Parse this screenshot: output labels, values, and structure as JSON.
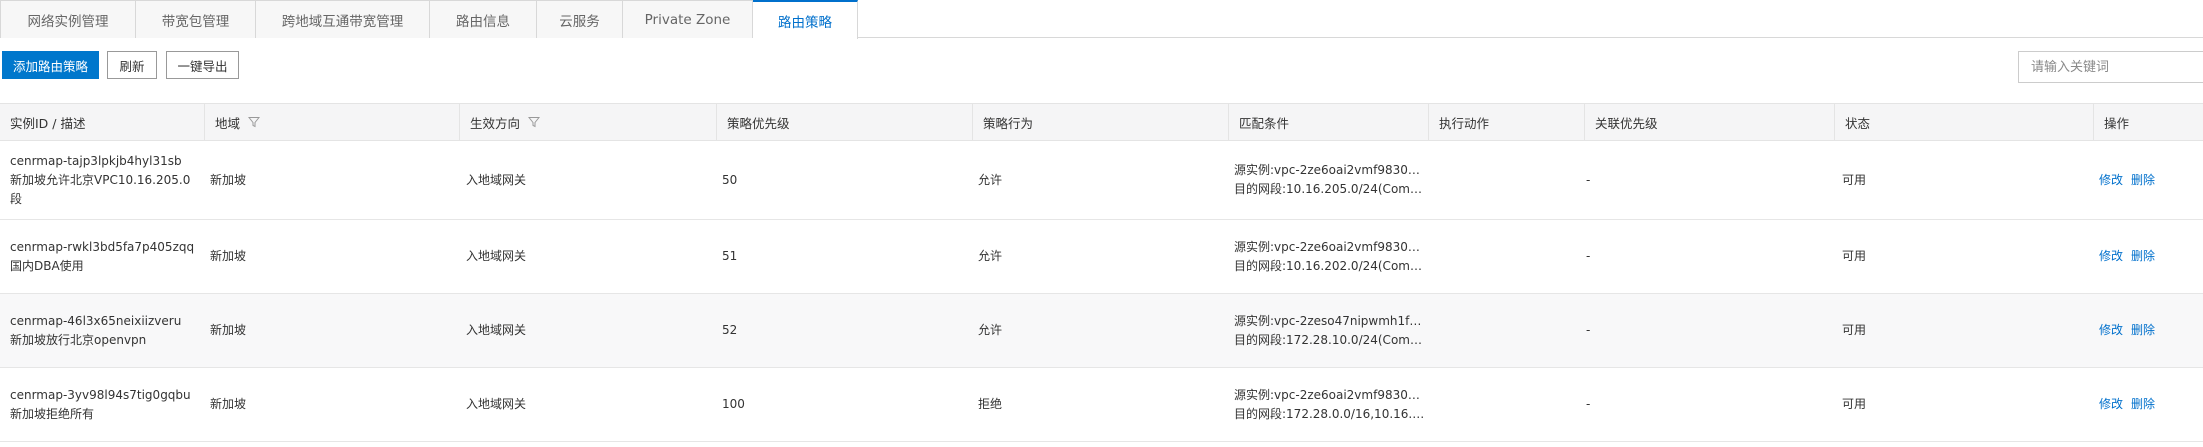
{
  "tabs": [
    {
      "label": "网络实例管理",
      "active": false
    },
    {
      "label": "带宽包管理",
      "active": false
    },
    {
      "label": "跨地域互通带宽管理",
      "active": false
    },
    {
      "label": "路由信息",
      "active": false
    },
    {
      "label": "云服务",
      "active": false
    },
    {
      "label": "Private Zone",
      "active": false
    },
    {
      "label": "路由策略",
      "active": true
    }
  ],
  "toolbar": {
    "add_label": "添加路由策略",
    "refresh_label": "刷新",
    "export_label": "一键导出",
    "search_placeholder": "请输入关键词"
  },
  "table": {
    "columns": [
      "实例ID / 描述",
      "地域",
      "生效方向",
      "策略优先级",
      "策略行为",
      "匹配条件",
      "执行动作",
      "关联优先级",
      "状态",
      "操作"
    ],
    "rows": [
      {
        "id": "cenrmap-tajp3lpkjb4hyl31sb",
        "desc": [
          "新加坡允许北京VPC10.16.205.0",
          "段"
        ],
        "region": "新加坡",
        "direction": "入地域网关",
        "priority": "50",
        "action": "允许",
        "match": [
          "源实例:vpc-2ze6oai2vmf9830m...",
          "目的网段:10.16.205.0/24(Compl..."
        ],
        "exec": "",
        "assoc": "-",
        "status": "可用",
        "ops": [
          "修改",
          "删除"
        ]
      },
      {
        "id": "cenrmap-rwkl3bd5fa7p405zqq",
        "desc": [
          "国内DBA使用"
        ],
        "region": "新加坡",
        "direction": "入地域网关",
        "priority": "51",
        "action": "允许",
        "match": [
          "源实例:vpc-2ze6oai2vmf9830m...",
          "目的网段:10.16.202.0/24(Compl..."
        ],
        "exec": "",
        "assoc": "-",
        "status": "可用",
        "ops": [
          "修改",
          "删除"
        ]
      },
      {
        "id": "cenrmap-46l3x65neixiizveru",
        "desc": [
          "新加坡放行北京openvpn"
        ],
        "region": "新加坡",
        "direction": "入地域网关",
        "priority": "52",
        "action": "允许",
        "match": [
          "源实例:vpc-2zeso47nipwmh1fb...",
          "目的网段:172.28.10.0/24(Compl..."
        ],
        "exec": "",
        "assoc": "-",
        "status": "可用",
        "ops": [
          "修改",
          "删除"
        ]
      },
      {
        "id": "cenrmap-3yv98l94s7tig0gqbu",
        "desc": [
          "新加坡拒绝所有"
        ],
        "region": "新加坡",
        "direction": "入地域网关",
        "priority": "100",
        "action": "拒绝",
        "match": [
          "源实例:vpc-2ze6oai2vmf9830m...",
          "目的网段:172.28.0.0/16,10.16.0...."
        ],
        "exec": "",
        "assoc": "-",
        "status": "可用",
        "ops": [
          "修改",
          "删除"
        ]
      }
    ]
  },
  "icons": {
    "filter": "filter-icon"
  },
  "colors": {
    "accent": "#0070cc",
    "primary_button": "#0077cc",
    "header_bg": "#f5f5f6"
  }
}
